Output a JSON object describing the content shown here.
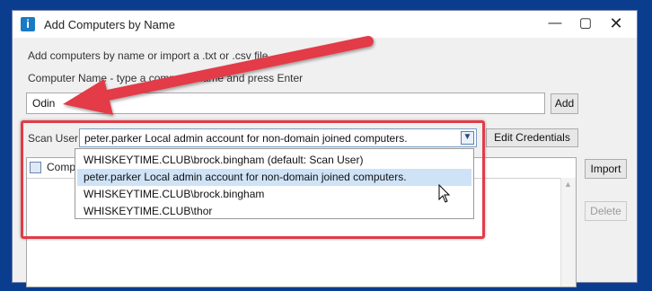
{
  "window": {
    "title": "Add Computers by Name",
    "app_icon": "i",
    "controls": {
      "minimize": "—",
      "maximize": "▢",
      "close": "✕"
    }
  },
  "intro_text": "Add computers by name or import a .txt or .csv file.",
  "computer_name": {
    "label": "Computer Name - type a computer name and press Enter",
    "value": "Odin",
    "add_label": "Add"
  },
  "scan_user": {
    "label": "Scan User",
    "selected": "peter.parker Local admin account for non-domain joined computers.",
    "edit_label": "Edit Credentials",
    "options": [
      "WHISKEYTIME.CLUB\\brock.bingham (default: Scan User)",
      "peter.parker Local admin account for non-domain joined computers.",
      "WHISKEYTIME.CLUB\\brock.bingham",
      "WHISKEYTIME.CLUB\\thor"
    ],
    "hovered_index": 1
  },
  "grid": {
    "header": "Computer Name"
  },
  "buttons": {
    "import": "Import",
    "delete": "Delete"
  },
  "colors": {
    "annotation": "#e33b47",
    "background": "#0b3d8f"
  }
}
